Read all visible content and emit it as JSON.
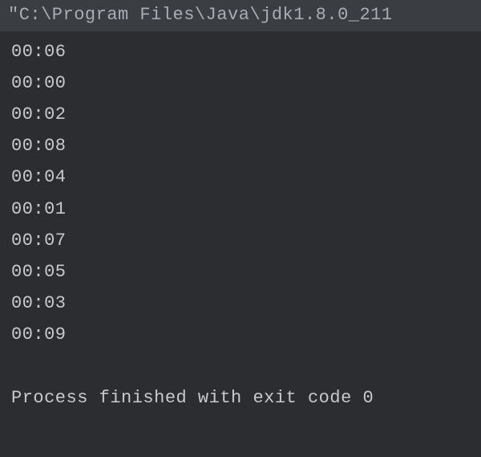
{
  "header": {
    "command": "\"C:\\Program Files\\Java\\jdk1.8.0_211"
  },
  "output": {
    "lines": [
      "00:06",
      "00:00",
      "00:02",
      "00:08",
      "00:04",
      "00:01",
      "00:07",
      "00:05",
      "00:03",
      "00:09"
    ]
  },
  "footer": {
    "exit_message": "Process finished with exit code 0"
  }
}
